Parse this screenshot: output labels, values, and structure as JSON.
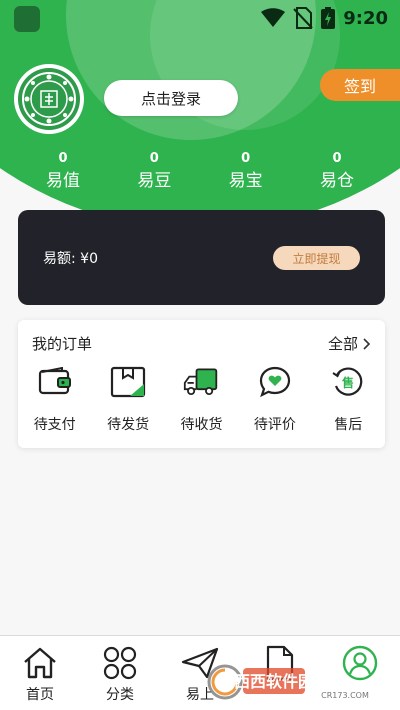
{
  "status_bar": {
    "time": "9:20"
  },
  "header": {
    "login_label": "点击登录",
    "signin_label": "签到"
  },
  "stats": [
    {
      "value": "0",
      "label": "易值"
    },
    {
      "value": "0",
      "label": "易豆"
    },
    {
      "value": "0",
      "label": "易宝"
    },
    {
      "value": "0",
      "label": "易仓"
    }
  ],
  "balance": {
    "text": "易额: ¥0",
    "withdraw_label": "立即提现"
  },
  "orders": {
    "title": "我的订单",
    "all_label": "全部",
    "items": [
      {
        "label": "待支付",
        "icon": "wallet-icon"
      },
      {
        "label": "待发货",
        "icon": "package-icon"
      },
      {
        "label": "待收货",
        "icon": "truck-icon"
      },
      {
        "label": "待评价",
        "icon": "heart-chat-icon"
      },
      {
        "label": "售后",
        "icon": "after-sales-icon"
      }
    ]
  },
  "tabbar": [
    {
      "label": "首页",
      "icon": "home-icon"
    },
    {
      "label": "分类",
      "icon": "category-icon"
    },
    {
      "label": "易上",
      "icon": "paper-plane-icon"
    },
    {
      "label": "",
      "icon": "document-icon"
    },
    {
      "label": "",
      "icon": "profile-icon"
    }
  ],
  "watermark": {
    "text": "西西软件园",
    "sub": "CR173.COM"
  },
  "colors": {
    "brand_green": "#2fb34f",
    "signin_orange": "#ef8f2a",
    "card_dark": "#22232a",
    "withdraw_bg": "#f6d9bd"
  }
}
